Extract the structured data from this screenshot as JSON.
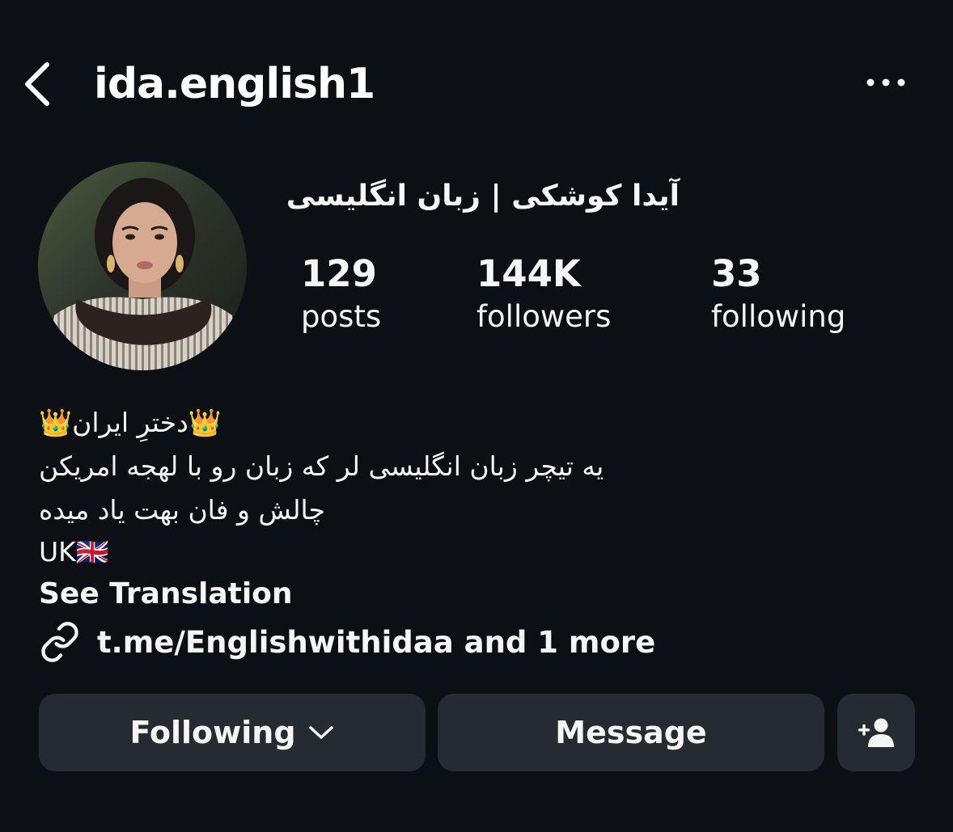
{
  "header": {
    "username": "ida.english1",
    "back_icon": "chevron-left-icon",
    "more_icon": "more-horizontal-icon"
  },
  "profile": {
    "display_name": "آیدا کوشکی | زبان انگلیسی",
    "stats": {
      "posts_count": "129",
      "posts_label": "posts",
      "followers_count": "144K",
      "followers_label": "followers",
      "following_count": "33",
      "following_label": "following"
    },
    "bio": {
      "line1": "👑دخترِ ایران👑",
      "line2": "یه تیچر زبان انگلیسی لر که زبان رو با لهجه امریکن",
      "line3": "چالش و فان بهت یاد میده",
      "line4": "UK🇬🇧",
      "see_translation": "See Translation"
    },
    "link": {
      "icon": "link-icon",
      "text": "t.me/Englishwithidaa and 1 more"
    }
  },
  "actions": {
    "following_label": "Following",
    "following_icon": "chevron-down-icon",
    "message_label": "Message",
    "suggest_icon": "add-person-icon"
  },
  "colors": {
    "background": "#0c0f14",
    "button_bg": "#262a31",
    "text": "#f5f5f5"
  }
}
